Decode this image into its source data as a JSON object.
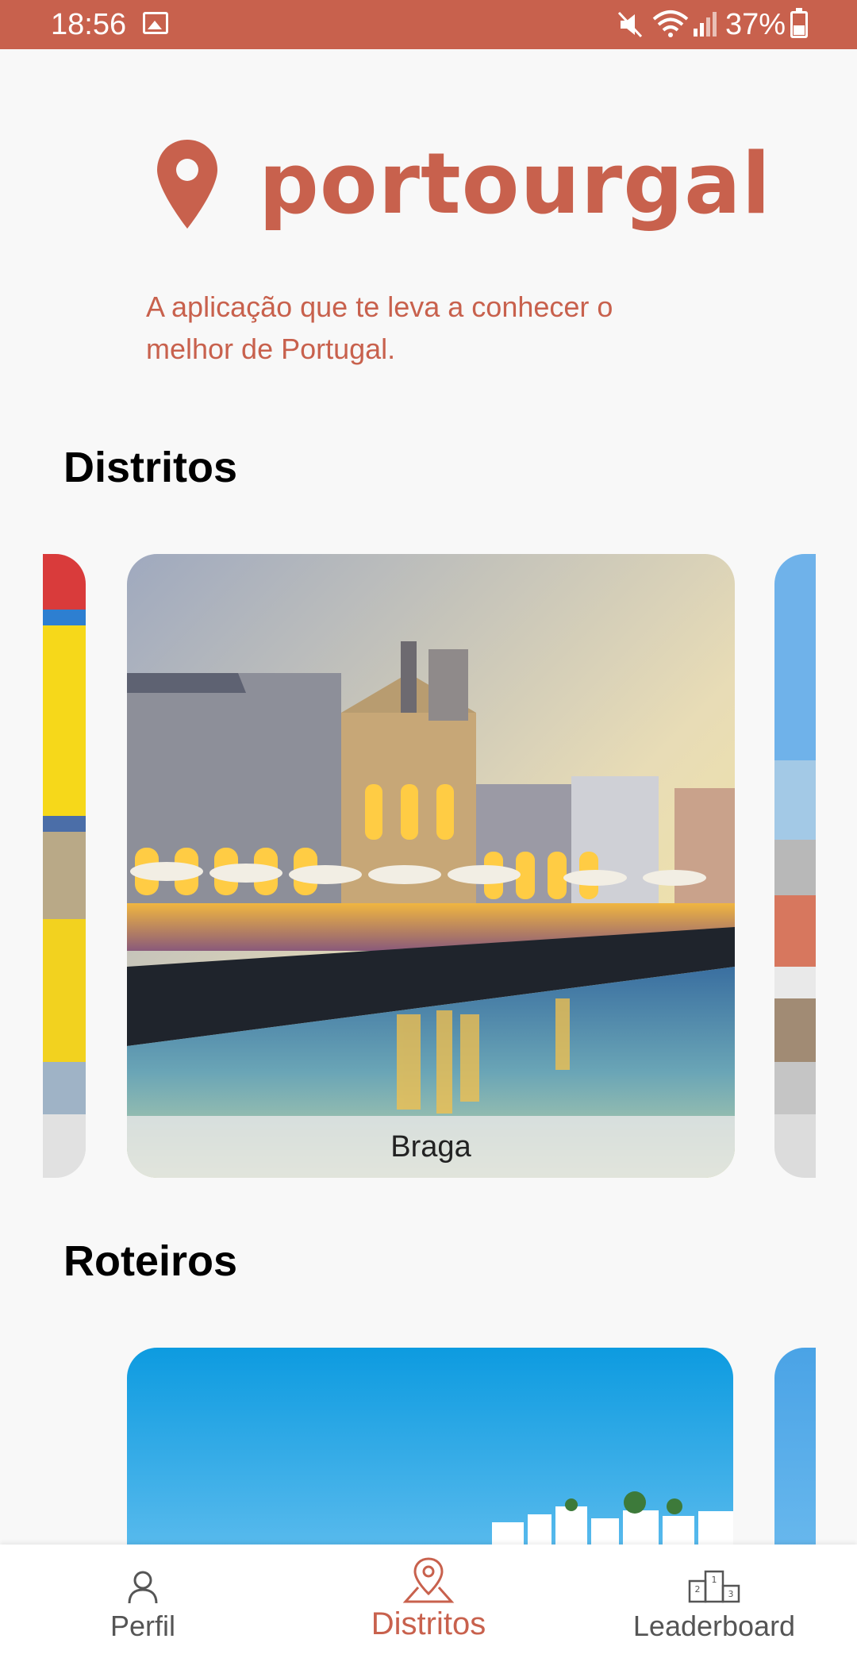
{
  "status_bar": {
    "time": "18:56",
    "battery_percent": "37%",
    "icons": [
      "gallery-icon",
      "mute-icon",
      "wifi-icon",
      "signal-icon",
      "battery-charging-icon"
    ]
  },
  "header": {
    "logo_text": "portourgal",
    "logo_icon": "location-pin-icon",
    "tagline": "A aplicação que te leva a conhecer o melhor de Portugal."
  },
  "sections": {
    "distritos": {
      "title": "Distritos",
      "cards": [
        {
          "label": ""
        },
        {
          "label": "Braga"
        },
        {
          "label": ""
        }
      ]
    },
    "roteiros": {
      "title": "Roteiros"
    }
  },
  "bottom_nav": {
    "items": [
      {
        "label": "Perfil",
        "icon": "person-icon",
        "active": false
      },
      {
        "label": "Distritos",
        "icon": "location-pin-icon",
        "active": true
      },
      {
        "label": "Leaderboard",
        "icon": "podium-icon",
        "active": false
      }
    ]
  },
  "colors": {
    "accent": "#c8614d",
    "background": "#f8f8f8",
    "nav_inactive": "#555555"
  }
}
